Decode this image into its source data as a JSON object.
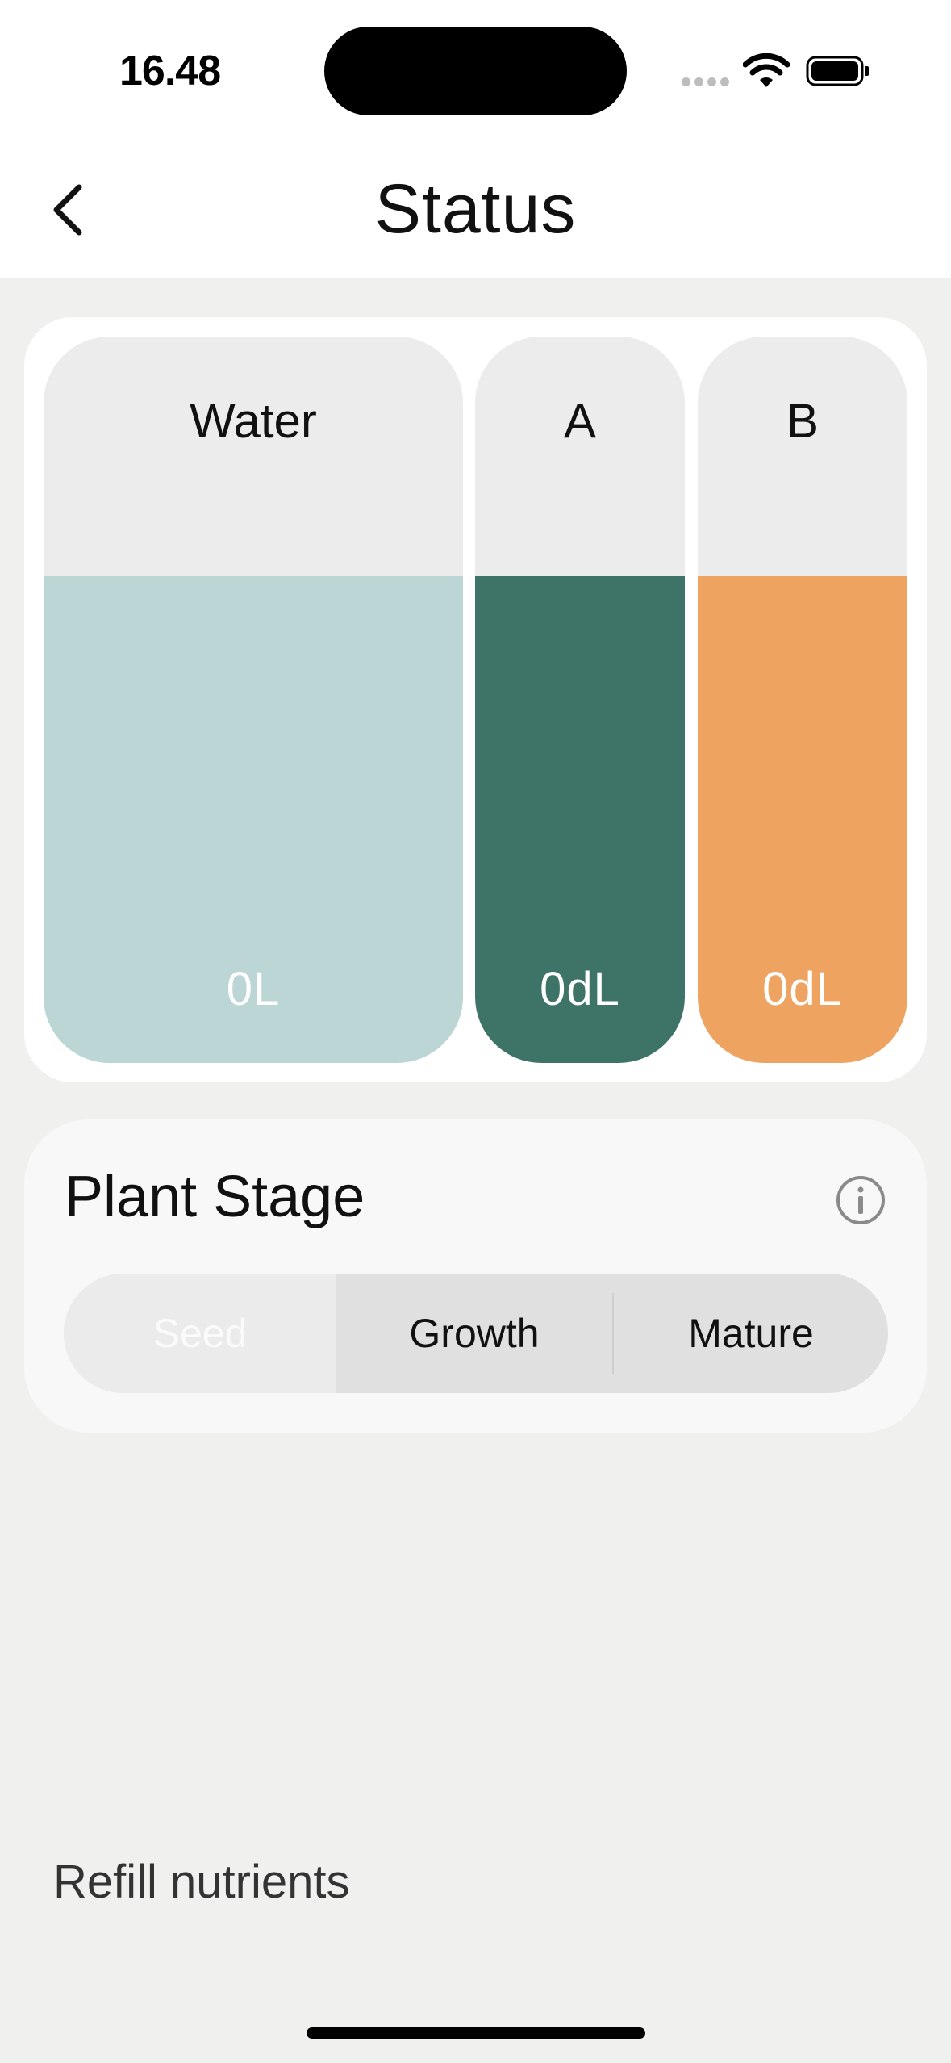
{
  "status_bar": {
    "time": "16.48"
  },
  "nav": {
    "title": "Status"
  },
  "tanks": [
    {
      "label": "Water",
      "value": "0L",
      "fill_percent": 67,
      "fill_color": "#bcd6d5"
    },
    {
      "label": "A",
      "value": "0dL",
      "fill_percent": 67,
      "fill_color": "#3e7367"
    },
    {
      "label": "B",
      "value": "0dL",
      "fill_percent": 67,
      "fill_color": "#efa361"
    }
  ],
  "plant_stage": {
    "title": "Plant Stage",
    "options": [
      "Seed",
      "Growth",
      "Mature"
    ],
    "selected": "Seed"
  },
  "footer": {
    "refill_label": "Refill nutrients"
  },
  "icons": {
    "back": "chevron-left-icon",
    "info": "info-circle-icon",
    "wifi": "wifi-icon",
    "battery": "battery-icon"
  }
}
